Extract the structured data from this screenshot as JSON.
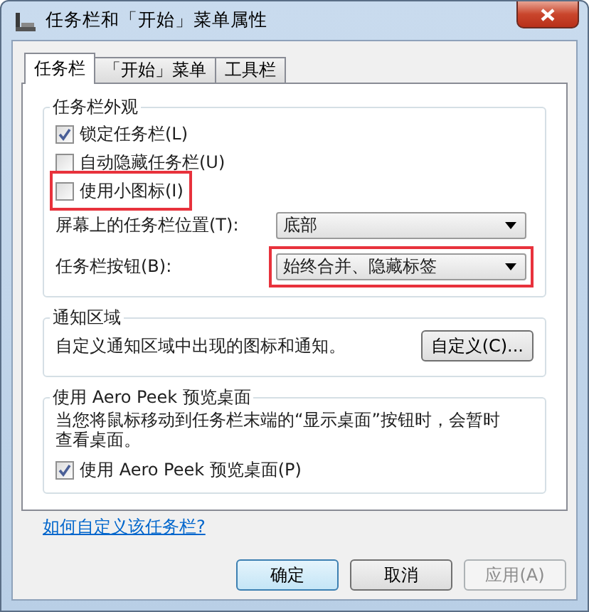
{
  "window": {
    "title": "任务栏和「开始」菜单属性"
  },
  "tabs": [
    {
      "label": "任务栏",
      "selected": true
    },
    {
      "label": "「开始」菜单",
      "selected": false
    },
    {
      "label": "工具栏",
      "selected": false
    }
  ],
  "appearance": {
    "title": "任务栏外观",
    "options": [
      {
        "label": "锁定任务栏(L)",
        "checked": true,
        "highlighted": false
      },
      {
        "label": "自动隐藏任务栏(U)",
        "checked": false,
        "highlighted": false
      },
      {
        "label": "使用小图标(I)",
        "checked": false,
        "highlighted": true
      }
    ],
    "dropdowns": [
      {
        "label": "屏幕上的任务栏位置(T):",
        "value": "底部",
        "highlighted": false
      },
      {
        "label": "任务栏按钮(B):",
        "value": "始终合并、隐藏标签",
        "highlighted": true
      }
    ]
  },
  "notification_area": {
    "title": "通知区域",
    "text": "自定义通知区域中出现的图标和通知。",
    "button": "自定义(C)..."
  },
  "aero_peek": {
    "title": "使用 Aero Peek 预览桌面",
    "text": "当您将鼠标移动到任务栏末端的“显示桌面”按钮时，会暂时查看桌面。",
    "option": {
      "label": "使用 Aero Peek 预览桌面(P)",
      "checked": true
    }
  },
  "link": "如何自定义该任务栏?",
  "buttons": [
    {
      "label": "确定",
      "default": true,
      "disabled": false
    },
    {
      "label": "取消",
      "default": false,
      "disabled": false
    },
    {
      "label": "应用(A)",
      "default": false,
      "disabled": true
    }
  ]
}
